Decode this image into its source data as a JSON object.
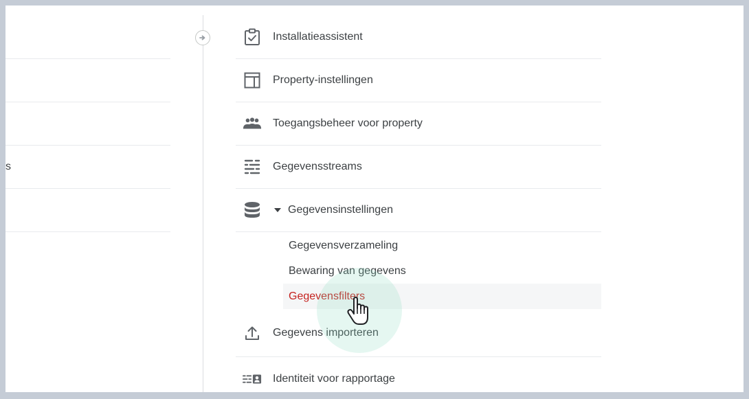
{
  "left_panel": {
    "visible_fragment": "s"
  },
  "menu": {
    "items": [
      {
        "label": "Installatieassistent",
        "icon": "clipboard-check-icon"
      },
      {
        "label": "Property-instellingen",
        "icon": "layout-panel-icon"
      },
      {
        "label": "Toegangsbeheer voor property",
        "icon": "people-group-icon"
      },
      {
        "label": "Gegevensstreams",
        "icon": "data-streams-icon"
      },
      {
        "label": "Gegevensinstellingen",
        "icon": "database-stack-icon",
        "expanded": true
      },
      {
        "label": "Gegevens importeren",
        "icon": "upload-icon"
      },
      {
        "label": "Identiteit voor rapportage",
        "icon": "reporting-identity-icon"
      }
    ],
    "submenu": [
      {
        "label": "Gegevensverzameling"
      },
      {
        "label": "Bewaring van gegevens"
      },
      {
        "label": "Gegevensfilters",
        "active": true
      }
    ]
  },
  "colors": {
    "active_text": "#c5221f",
    "active_bg": "#f5f6f7",
    "text": "#3c4043",
    "icon": "#5f6368",
    "click_glow": "#89dbbd",
    "frame_bg": "#c5ccd6"
  }
}
